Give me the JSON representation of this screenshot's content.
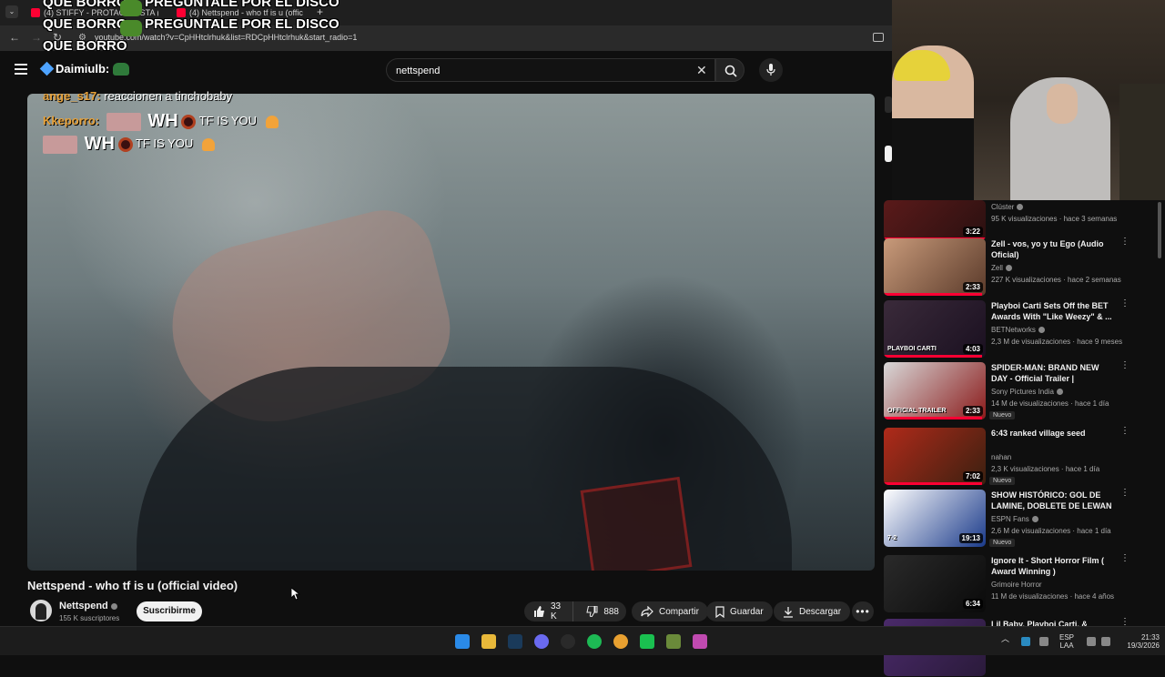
{
  "browser": {
    "tabs": [
      {
        "label": "(4) STIFFY - PROTAGONISTA (",
        "overlay": "QUE BORRO"
      },
      {
        "label": "(4) Nettspend - who tf is u (offic",
        "overlay": "PREGUNTALE POR EL DISCO"
      }
    ],
    "new_tab_icon": "plus-icon",
    "url": "youtube.com/watch?v=CpHHtclrhuk&list=RDCpHHtclrhuk&start_radio=1"
  },
  "overlay_texts": [
    "QUE BORRO",
    "PREGUNTALE POR EL DISCO",
    "QUE BORRO",
    "PREGUNTALE POR EL DISCO",
    "QUE BORRO"
  ],
  "header": {
    "channel_tag": "Daimiulb:",
    "search_value": "nettspend"
  },
  "chat": [
    {
      "user": "ange_s17:",
      "msg": "reaccionen a tinchobaby"
    },
    {
      "user": "Kkeporro:",
      "who": "WH",
      "msg": "TF IS YOU"
    },
    {
      "who": "WH",
      "msg": "TF IS YOU"
    }
  ],
  "video": {
    "title": "Nettspend - who tf is u (official video)",
    "channel": "Nettspend",
    "subscribers": "155 K suscriptores",
    "subscribe_label": "Suscribirme",
    "likes": "33 K",
    "dislikes": "888",
    "share_label": "Compartir",
    "save_label": "Guardar",
    "download_label": "Descargar"
  },
  "recommendations": [
    {
      "title": "",
      "channel": "Clúster",
      "meta": "95 K visualizaciones · hace 3 semanas",
      "duration": "3:22",
      "badge": "",
      "colors": [
        "#5a1a1a",
        "#2a1010"
      ]
    },
    {
      "title": "Zell - vos, yo y tu Ego (Audio Oficial)",
      "channel": "Zell",
      "meta": "227 K visualizaciones · hace 2 semanas",
      "duration": "2:33",
      "badge": "",
      "colors": [
        "#c89a7a",
        "#5a3a2a"
      ]
    },
    {
      "title": "Playboi Carti Sets Off the BET Awards With \"Like Weezy\" & ...",
      "channel": "BETNetworks",
      "meta": "2,3 M de visualizaciones · hace 9 meses",
      "duration": "4:03",
      "badge": "",
      "colors": [
        "#3a2a3a",
        "#1a1020"
      ],
      "thumb_text": "PLAYBOI CARTI"
    },
    {
      "title": "SPIDER-MAN: BRAND NEW DAY - Official Trailer | Exclusively In...",
      "channel": "Sony Pictures India",
      "meta": "14 M de visualizaciones · hace 1 día",
      "duration": "2:33",
      "badge": "Nuevo",
      "colors": [
        "#d8d8d8",
        "#8a1a1a"
      ],
      "thumb_text": "OFFICIAL TRAILER"
    },
    {
      "title": "6:43 ranked village seed",
      "channel": "nahan",
      "meta": "2,3 K visualizaciones · hace 1 día",
      "duration": "7:02",
      "badge": "Nuevo",
      "colors": [
        "#b02a1a",
        "#3a2010"
      ]
    },
    {
      "title": "SHOW HISTÓRICO: GOL DE LAMINE, DOBLETE DE LEWAN ...",
      "channel": "ESPN Fans",
      "meta": "2,6 M de visualizaciones · hace 1 día",
      "duration": "19:13",
      "badge": "Nuevo",
      "colors": [
        "#ffffff",
        "#1a3a8a"
      ],
      "thumb_text": "7-2"
    },
    {
      "title": "Ignore It - Short Horror Film ( Award Winning )",
      "channel": "Grimoire Horror",
      "meta": "11 M de visualizaciones · hace 4 años",
      "duration": "6:34",
      "badge": "",
      "colors": [
        "#2a2a2a",
        "#0a0a0a"
      ]
    },
    {
      "title": "Lil Baby, Playboi Carti, & Skooly",
      "channel": "",
      "meta": "",
      "duration": "",
      "badge": "",
      "colors": [
        "#4a2a6a",
        "#2a1a3a"
      ]
    }
  ],
  "taskbar": {
    "icons": [
      "windows-start-icon",
      "file-explorer-icon",
      "steam-icon",
      "discord-icon",
      "obs-icon",
      "spotify-icon",
      "chrome-icon",
      "green-app-icon",
      "minecraft-icon",
      "triangle-app-icon"
    ],
    "lang_1": "ESP",
    "lang_2": "LAA",
    "time": "21:33",
    "date": "19/3/2026"
  }
}
